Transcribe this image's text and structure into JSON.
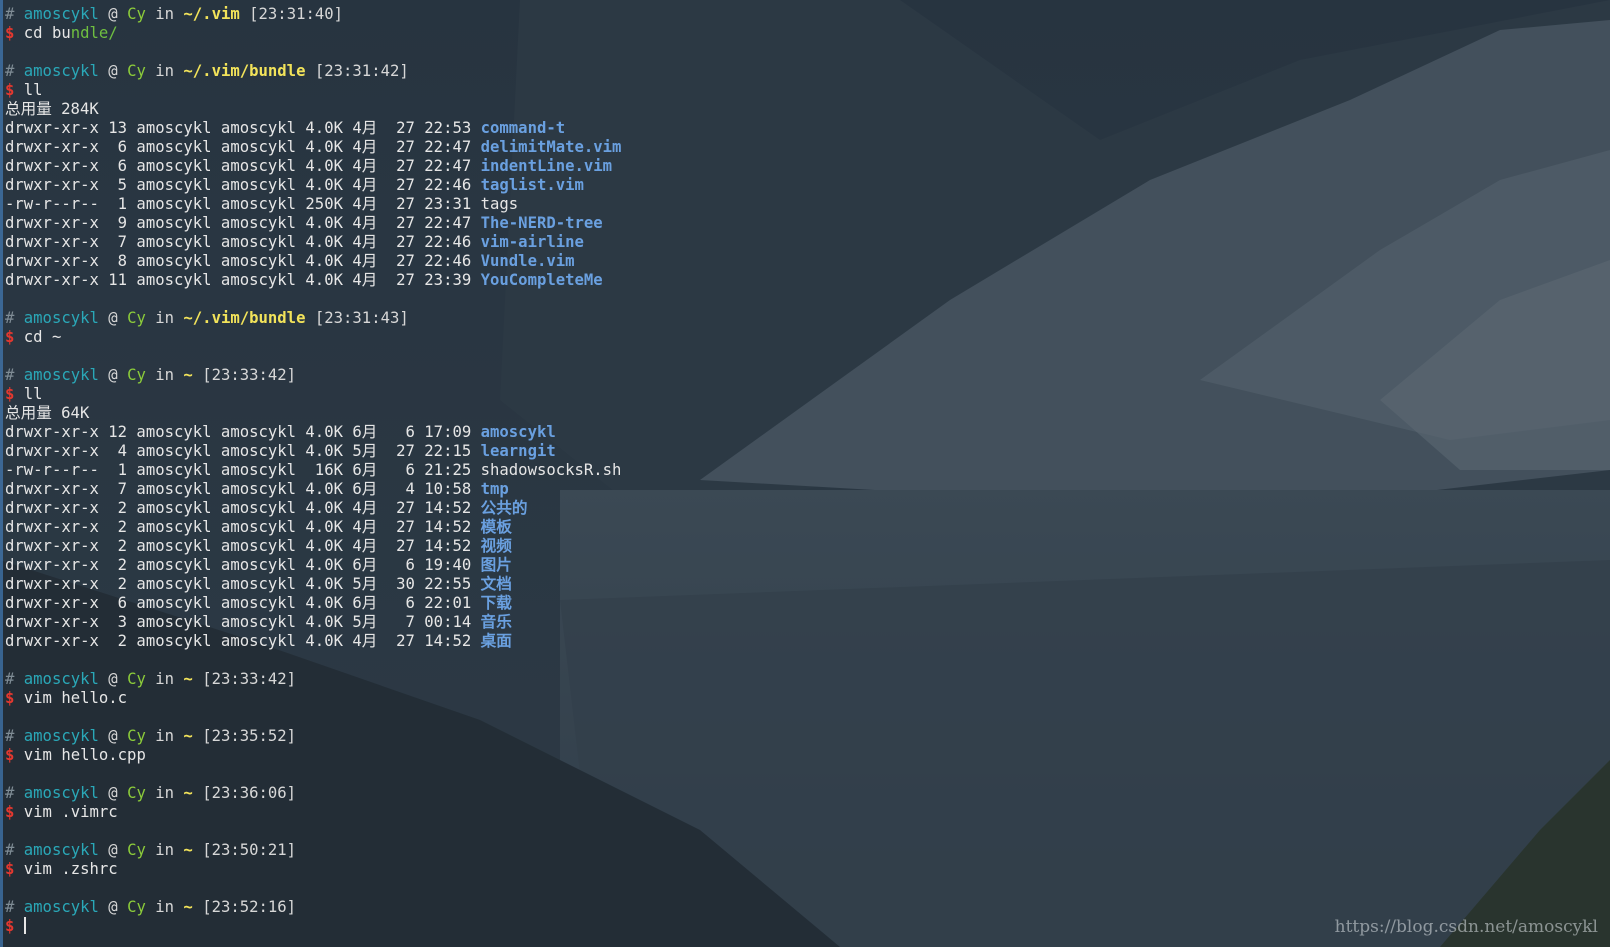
{
  "colors": {
    "background": "#2a3744",
    "user": "#2aa8b8",
    "host": "#8ccc3a",
    "path": "#f2e35a",
    "dollar": "#e3382f",
    "directory": "#6aa0e0"
  },
  "prompt": {
    "hash": "#",
    "user": "amoscykl",
    "at": "@",
    "host": "Cy",
    "in": "in",
    "dollar": "$"
  },
  "blocks": [
    {
      "path": "~/.vim",
      "time": "[23:31:40]",
      "cmd_pre": "cd bu",
      "cmd_hl": "ndle/",
      "output": []
    },
    {
      "path": "~/.vim/bundle",
      "time": "[23:31:42]",
      "cmd_pre": "ll",
      "cmd_hl": "",
      "output": [
        {
          "text": "总用量 284K"
        },
        {
          "meta": "drwxr-xr-x 13 amoscykl amoscykl 4.0K 4月  27 22:53 ",
          "name": "command-t",
          "type": "dir"
        },
        {
          "meta": "drwxr-xr-x  6 amoscykl amoscykl 4.0K 4月  27 22:47 ",
          "name": "delimitMate.vim",
          "type": "dir"
        },
        {
          "meta": "drwxr-xr-x  6 amoscykl amoscykl 4.0K 4月  27 22:47 ",
          "name": "indentLine.vim",
          "type": "dir"
        },
        {
          "meta": "drwxr-xr-x  5 amoscykl amoscykl 4.0K 4月  27 22:46 ",
          "name": "taglist.vim",
          "type": "dir"
        },
        {
          "meta": "-rw-r--r--  1 amoscykl amoscykl 250K 4月  27 23:31 ",
          "name": "tags",
          "type": "file"
        },
        {
          "meta": "drwxr-xr-x  9 amoscykl amoscykl 4.0K 4月  27 22:47 ",
          "name": "The-NERD-tree",
          "type": "dir"
        },
        {
          "meta": "drwxr-xr-x  7 amoscykl amoscykl 4.0K 4月  27 22:46 ",
          "name": "vim-airline",
          "type": "dir"
        },
        {
          "meta": "drwxr-xr-x  8 amoscykl amoscykl 4.0K 4月  27 22:46 ",
          "name": "Vundle.vim",
          "type": "dir"
        },
        {
          "meta": "drwxr-xr-x 11 amoscykl amoscykl 4.0K 4月  27 23:39 ",
          "name": "YouCompleteMe",
          "type": "dir"
        }
      ]
    },
    {
      "path": "~/.vim/bundle",
      "time": "[23:31:43]",
      "cmd_pre": "cd ~",
      "cmd_hl": "",
      "output": []
    },
    {
      "path": "~",
      "time": "[23:33:42]",
      "cmd_pre": "ll",
      "cmd_hl": "",
      "output": [
        {
          "text": "总用量 64K"
        },
        {
          "meta": "drwxr-xr-x 12 amoscykl amoscykl 4.0K 6月   6 17:09 ",
          "name": "amoscykl",
          "type": "dir"
        },
        {
          "meta": "drwxr-xr-x  4 amoscykl amoscykl 4.0K 5月  27 22:15 ",
          "name": "learngit",
          "type": "dir"
        },
        {
          "meta": "-rw-r--r--  1 amoscykl amoscykl  16K 6月   6 21:25 ",
          "name": "shadowsocksR.sh",
          "type": "file"
        },
        {
          "meta": "drwxr-xr-x  7 amoscykl amoscykl 4.0K 6月   4 10:58 ",
          "name": "tmp",
          "type": "dir"
        },
        {
          "meta": "drwxr-xr-x  2 amoscykl amoscykl 4.0K 4月  27 14:52 ",
          "name": "公共的",
          "type": "dir"
        },
        {
          "meta": "drwxr-xr-x  2 amoscykl amoscykl 4.0K 4月  27 14:52 ",
          "name": "模板",
          "type": "dir"
        },
        {
          "meta": "drwxr-xr-x  2 amoscykl amoscykl 4.0K 4月  27 14:52 ",
          "name": "视频",
          "type": "dir"
        },
        {
          "meta": "drwxr-xr-x  2 amoscykl amoscykl 4.0K 6月   6 19:40 ",
          "name": "图片",
          "type": "dir"
        },
        {
          "meta": "drwxr-xr-x  2 amoscykl amoscykl 4.0K 5月  30 22:55 ",
          "name": "文档",
          "type": "dir"
        },
        {
          "meta": "drwxr-xr-x  6 amoscykl amoscykl 4.0K 6月   6 22:01 ",
          "name": "下载",
          "type": "dir"
        },
        {
          "meta": "drwxr-xr-x  3 amoscykl amoscykl 4.0K 5月   7 00:14 ",
          "name": "音乐",
          "type": "dir"
        },
        {
          "meta": "drwxr-xr-x  2 amoscykl amoscykl 4.0K 4月  27 14:52 ",
          "name": "桌面",
          "type": "dir"
        }
      ]
    },
    {
      "path": "~",
      "time": "[23:33:42]",
      "cmd_pre": "vim hello.c",
      "cmd_hl": "",
      "output": []
    },
    {
      "path": "~",
      "time": "[23:35:52]",
      "cmd_pre": "vim hello.cpp",
      "cmd_hl": "",
      "output": []
    },
    {
      "path": "~",
      "time": "[23:36:06]",
      "cmd_pre": "vim .vimrc",
      "cmd_hl": "",
      "output": []
    },
    {
      "path": "~",
      "time": "[23:50:21]",
      "cmd_pre": "vim .zshrc",
      "cmd_hl": "",
      "output": []
    },
    {
      "path": "~",
      "time": "[23:52:16]",
      "cmd_pre": "",
      "cmd_hl": "",
      "output": [],
      "active": true
    }
  ],
  "watermark": "https://blog.csdn.net/amoscykl"
}
